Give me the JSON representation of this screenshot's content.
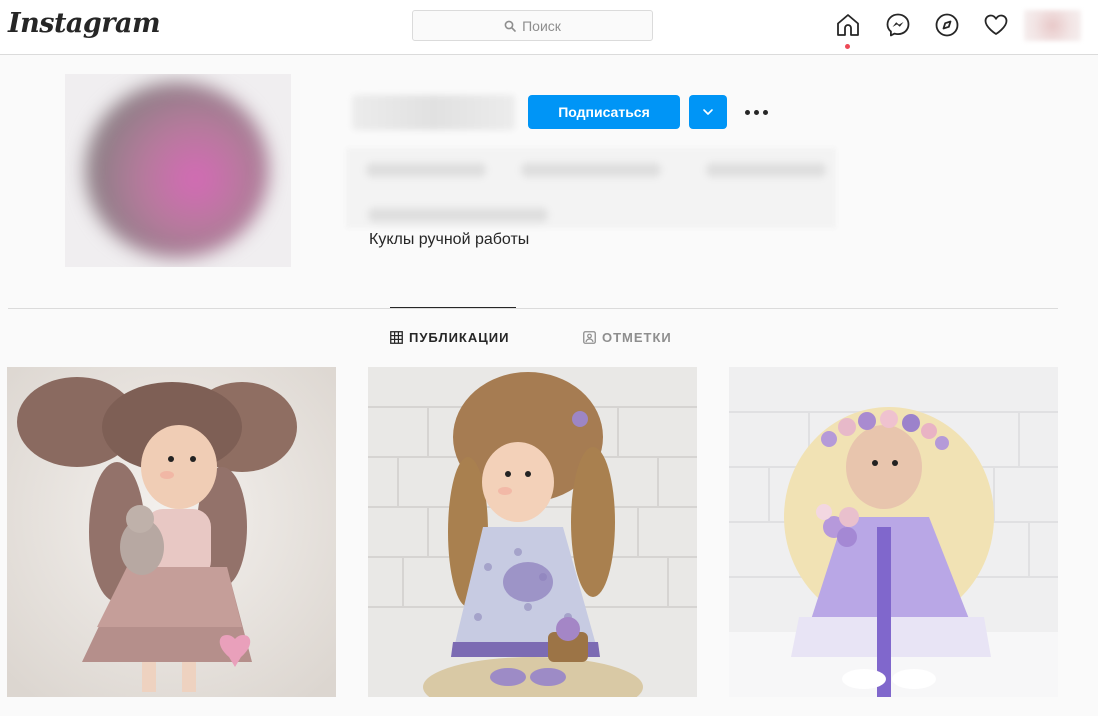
{
  "header": {
    "logo": "Instagram",
    "search_placeholder": "Поиск",
    "icons": [
      "home-icon",
      "messenger-icon",
      "explore-icon",
      "heart-icon",
      "profile-avatar"
    ]
  },
  "profile": {
    "follow_label": "Подписаться",
    "bio": "Куклы ручной работы"
  },
  "tabs": [
    {
      "label": "ПУБЛИКАЦИИ",
      "icon": "grid-icon",
      "active": true
    },
    {
      "label": "ОТМЕТКИ",
      "icon": "tagged-icon",
      "active": false
    }
  ],
  "posts": [
    {
      "description_icon": "doll-photo"
    },
    {
      "description_icon": "doll-photo"
    },
    {
      "description_icon": "doll-photo"
    }
  ],
  "colors": {
    "accent": "#0095f6",
    "notification": "#ed4956",
    "border": "#dbdbdb",
    "text": "#262626",
    "muted": "#8e8e8e"
  }
}
